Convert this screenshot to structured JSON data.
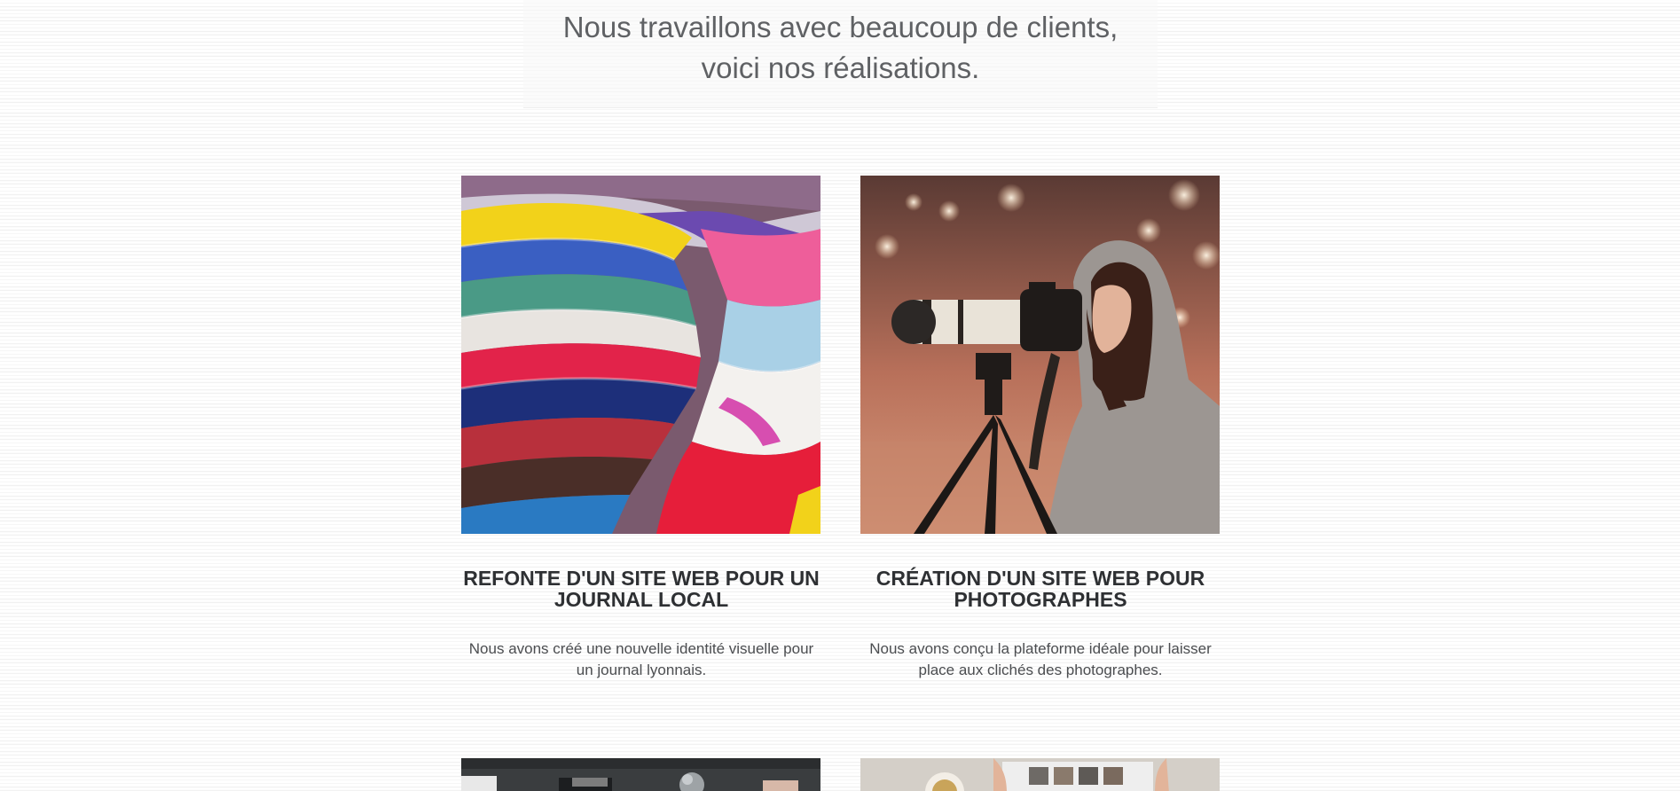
{
  "intro": {
    "line1": "Nous travaillons avec beaucoup de clients,",
    "line2": "voici nos réalisations."
  },
  "projects": [
    {
      "title": "REFONTE D'UN SITE WEB POUR UN JOURNAL LOCAL",
      "description": "Nous avons créé une nouvelle identité visuelle pour un journal lyonnais.",
      "image_icon": "magazines-photo"
    },
    {
      "title": "CRÉATION D'UN SITE WEB POUR PHOTOGRAPHES",
      "description": "Nous avons conçu la plateforme idéale pour laisser place aux clichés des photographes.",
      "image_icon": "photographer-photo"
    },
    {
      "image_icon": "studio-photo"
    },
    {
      "image_icon": "desk-photos-photo"
    }
  ],
  "colors": {
    "intro_text": "#5f6164",
    "title_text": "#2e3033",
    "desc_text": "#4b4d50"
  }
}
